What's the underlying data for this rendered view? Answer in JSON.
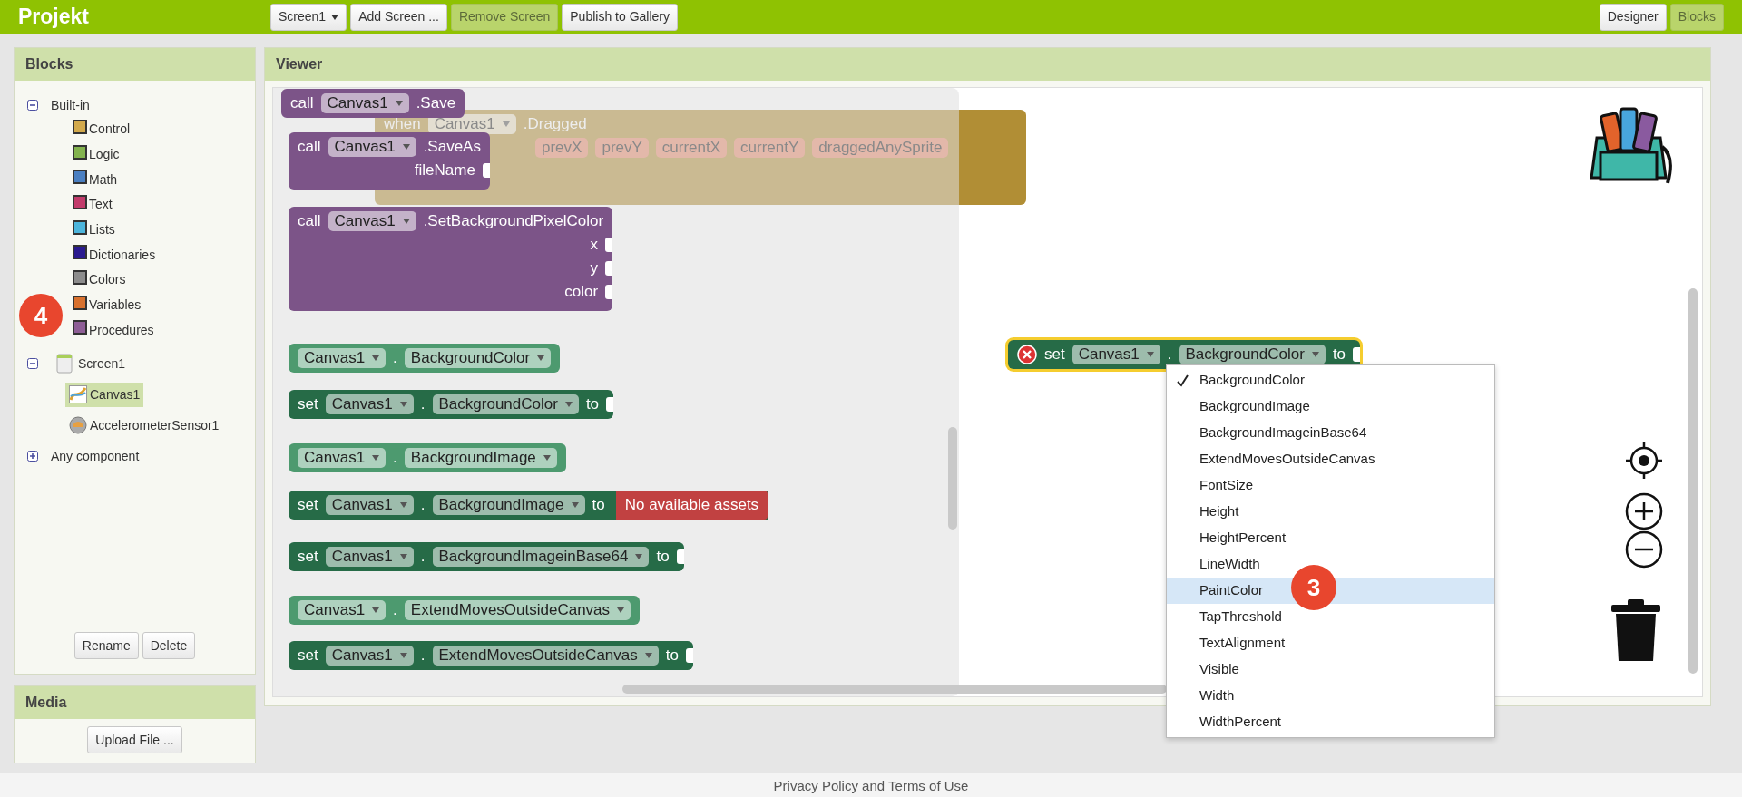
{
  "app_bar": {
    "title": "Projekt",
    "screen_menu": "Screen1",
    "buttons": [
      {
        "label": "Add Screen ...",
        "disabled": false
      },
      {
        "label": "Remove Screen",
        "disabled": true
      },
      {
        "label": "Publish to Gallery",
        "disabled": false
      }
    ],
    "views": [
      {
        "label": "Designer",
        "selected": false
      },
      {
        "label": "Blocks",
        "selected": true
      }
    ]
  },
  "blocks_panel": {
    "title": "Blocks",
    "tree": [
      {
        "kind": "group",
        "label": "Built-in",
        "expanded": true,
        "children": [
          {
            "kind": "category",
            "label": "Control",
            "color": "#d2a94c"
          },
          {
            "kind": "category",
            "label": "Logic",
            "color": "#83b34e"
          },
          {
            "kind": "category",
            "label": "Math",
            "color": "#4a7fc1"
          },
          {
            "kind": "category",
            "label": "Text",
            "color": "#c23b6b"
          },
          {
            "kind": "category",
            "label": "Lists",
            "color": "#4cb5dc"
          },
          {
            "kind": "category",
            "label": "Dictionaries",
            "color": "#2a1a8f"
          },
          {
            "kind": "category",
            "label": "Colors",
            "color": "#8c8c8c"
          },
          {
            "kind": "category",
            "label": "Variables",
            "color": "#d8712e"
          },
          {
            "kind": "category",
            "label": "Procedures",
            "color": "#8e5e96"
          }
        ]
      },
      {
        "kind": "screen",
        "label": "Screen1",
        "expanded": true,
        "children": [
          {
            "kind": "canvas",
            "label": "Canvas1",
            "selected": true
          },
          {
            "kind": "sensor",
            "label": "AccelerometerSensor1",
            "selected": false
          }
        ]
      },
      {
        "kind": "group",
        "label": "Any component",
        "expanded": false
      }
    ],
    "buttons": [
      "Rename",
      "Delete"
    ]
  },
  "media_panel": {
    "title": "Media",
    "button": "Upload File ..."
  },
  "viewer": {
    "title": "Viewer",
    "background_block": {
      "keyword": "when",
      "component": "Canvas1",
      "event": ".Dragged",
      "params": [
        "prevX",
        "prevY",
        "currentX",
        "currentY",
        "draggedAnySprite"
      ]
    },
    "flyout_blocks": [
      {
        "kind": "call",
        "keyword": "call",
        "component": "Canvas1",
        "member": ".Save"
      },
      {
        "kind": "call",
        "keyword": "call",
        "component": "Canvas1",
        "member": ".SaveAs",
        "args": [
          "fileName"
        ]
      },
      {
        "kind": "call",
        "keyword": "call",
        "component": "Canvas1",
        "member": ".SetBackgroundPixelColor",
        "args": [
          "x",
          "y",
          "color"
        ]
      },
      {
        "kind": "getter",
        "component": "Canvas1",
        "dot": ".",
        "property": "BackgroundColor"
      },
      {
        "kind": "setter",
        "keyword": "set",
        "component": "Canvas1",
        "dot": ".",
        "property": "BackgroundColor",
        "to": "to"
      },
      {
        "kind": "getter",
        "component": "Canvas1",
        "dot": ".",
        "property": "BackgroundImage"
      },
      {
        "kind": "setter",
        "keyword": "set",
        "component": "Canvas1",
        "dot": ".",
        "property": "BackgroundImage",
        "to": "to",
        "attached": "No available assets"
      },
      {
        "kind": "setter",
        "keyword": "set",
        "component": "Canvas1",
        "dot": ".",
        "property": "BackgroundImageinBase64",
        "to": "to"
      },
      {
        "kind": "getter",
        "component": "Canvas1",
        "dot": ".",
        "property": "ExtendMovesOutsideCanvas"
      },
      {
        "kind": "setter",
        "keyword": "set",
        "component": "Canvas1",
        "dot": ".",
        "property": "ExtendMovesOutsideCanvas",
        "to": "to"
      }
    ],
    "workspace_block": {
      "keyword": "set",
      "component": "Canvas1",
      "dot": ".",
      "property": "BackgroundColor",
      "to": "to",
      "selected": true,
      "error": true
    },
    "dropdown": {
      "items": [
        {
          "label": "BackgroundColor",
          "checked": true,
          "highlighted": false
        },
        {
          "label": "BackgroundImage",
          "checked": false,
          "highlighted": false
        },
        {
          "label": "BackgroundImageinBase64",
          "checked": false,
          "highlighted": false
        },
        {
          "label": "ExtendMovesOutsideCanvas",
          "checked": false,
          "highlighted": false
        },
        {
          "label": "FontSize",
          "checked": false,
          "highlighted": false
        },
        {
          "label": "Height",
          "checked": false,
          "highlighted": false
        },
        {
          "label": "HeightPercent",
          "checked": false,
          "highlighted": false
        },
        {
          "label": "LineWidth",
          "checked": false,
          "highlighted": false
        },
        {
          "label": "PaintColor",
          "checked": false,
          "highlighted": true
        },
        {
          "label": "TapThreshold",
          "checked": false,
          "highlighted": false
        },
        {
          "label": "TextAlignment",
          "checked": false,
          "highlighted": false
        },
        {
          "label": "Visible",
          "checked": false,
          "highlighted": false
        },
        {
          "label": "Width",
          "checked": false,
          "highlighted": false
        },
        {
          "label": "WidthPercent",
          "checked": false,
          "highlighted": false
        }
      ]
    }
  },
  "markers": [
    "4",
    "3"
  ],
  "footer": "Privacy Policy and Terms of Use"
}
